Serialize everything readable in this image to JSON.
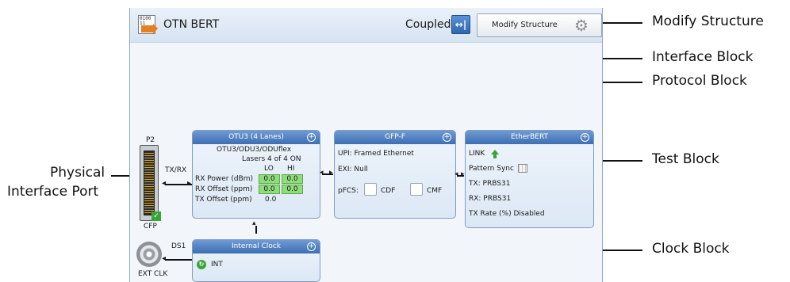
{
  "header": {
    "title": "OTN BERT",
    "coupled_label": "Coupled",
    "modify_structure_label": "Modify Structure"
  },
  "port": {
    "label_top": "P2",
    "label_bottom": "CFP",
    "txrx_label": "TX/RX",
    "ds1_label": "DS1",
    "ext_clk_label": "EXT CLK"
  },
  "interface_block": {
    "title": "OTU3 (4 Lanes)",
    "mapping": "OTU3/ODU3/ODUflex",
    "lasers": "Lasers 4 of 4 ON",
    "col_lo": "LO",
    "col_hi": "HI",
    "rows": [
      {
        "label": "RX Power (dBm)",
        "lo": "0.0",
        "hi": "0.0"
      },
      {
        "label": "RX Offset (ppm)",
        "lo": "0.0",
        "hi": "0.0"
      }
    ],
    "tx_offset_label": "TX Offset (ppm)",
    "tx_offset_value": "0.0"
  },
  "protocol_block": {
    "title": "GFP-F",
    "upi": "UPI: Framed Ethernet",
    "exi": "EXI: Null",
    "pfcs": "pFCS:",
    "cdf": "CDF",
    "cmf": "CMF"
  },
  "test_block": {
    "title": "EtherBERT",
    "link": "LINK",
    "pattern_sync": "Pattern Sync",
    "tx": "TX:  PRBS31",
    "rx": "RX:  PRBS31",
    "tx_rate": "TX Rate (%)  Disabled"
  },
  "clock_block": {
    "title": "Internal Clock",
    "value": "INT"
  },
  "callouts": {
    "modify_structure": "Modify Structure",
    "interface_block": "Interface Block",
    "protocol_block": "Protocol Block",
    "test_block": "Test Block",
    "physical_line1": "Physical",
    "physical_line2": "Interface Port",
    "clock_block": "Clock Block"
  },
  "colors": {
    "header_blue": "#3d6fb3",
    "green_cell": "#8fdc7a",
    "accent_orange": "#e67e22"
  }
}
